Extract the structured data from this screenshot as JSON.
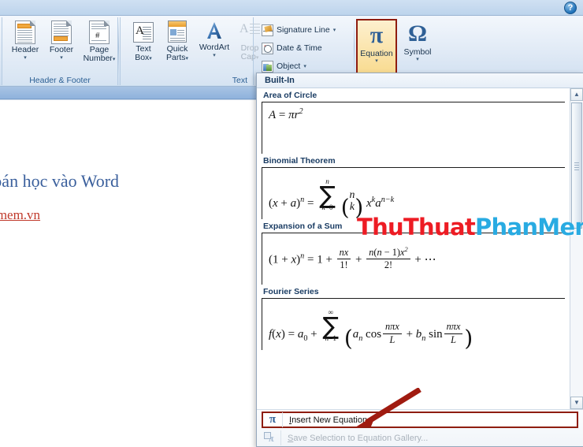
{
  "window": {
    "help_icon": "help-circle-icon",
    "help_label": "?"
  },
  "ribbon": {
    "groups": [
      {
        "label": "Header & Footer"
      },
      {
        "label": "Text"
      }
    ],
    "header_footer": {
      "buttons": [
        {
          "label": "Header",
          "caret": "▾",
          "icon": "header-document-icon"
        },
        {
          "label": "Footer",
          "caret": "▾",
          "icon": "footer-document-icon"
        },
        {
          "label_line1": "Page",
          "label_line2": "Number",
          "caret": "▾",
          "icon": "page-number-icon"
        }
      ]
    },
    "text_group": {
      "buttons": [
        {
          "label_line1": "Text",
          "label_line2": "Box",
          "caret": "▾",
          "icon": "text-box-icon",
          "disabled": false
        },
        {
          "label_line1": "Quick",
          "label_line2": "Parts",
          "caret": "▾",
          "icon": "quick-parts-icon",
          "disabled": false
        },
        {
          "label_line1": "WordArt",
          "label_line2": "",
          "caret": "▾",
          "icon": "wordart-icon",
          "disabled": false
        },
        {
          "label_line1": "Drop",
          "label_line2": "Cap",
          "caret": "▾",
          "icon": "drop-cap-icon",
          "disabled": true
        }
      ],
      "commands": [
        {
          "label": "Signature Line",
          "caret": "▾",
          "icon": "signature-line-icon"
        },
        {
          "label": "Date & Time",
          "caret": "",
          "icon": "date-time-icon"
        },
        {
          "label": "Object",
          "caret": "▾",
          "icon": "object-icon"
        }
      ],
      "equation_button": {
        "label": "Equation",
        "glyph": "π",
        "caret": "▾",
        "icon": "equation-pi-icon",
        "active": true,
        "highlight_color": "#8f1d10"
      },
      "symbol_button": {
        "label": "Symbol",
        "glyph": "Ω",
        "caret": "▾",
        "icon": "symbol-omega-icon"
      }
    }
  },
  "document": {
    "heading": "ức toán học vào Word",
    "link": "uatphanmem.vn"
  },
  "gallery": {
    "title": "Built-In",
    "items": [
      {
        "label": "Area of Circle",
        "formula_plain": "A = πr²"
      },
      {
        "label": "Binomial Theorem",
        "formula_plain": "(x + a)^n = Σ(k=0..n) (n choose k) x^k a^(n−k)"
      },
      {
        "label": "Expansion of a Sum",
        "formula_plain": "(1 + x)^n = 1 + nx/1! + n(n−1)x²/2! + ···"
      },
      {
        "label": "Fourier Series",
        "formula_plain": "f(x) = a₀ + Σ(n=1..∞) (aₙ cos(nπx/L) + bₙ sin(nπx/L))"
      }
    ],
    "scrollbar": {
      "up_arrow": "▲",
      "down_arrow": "▼"
    },
    "commands": [
      {
        "label": "Insert New Equation",
        "icon": "equation-pi-icon",
        "disabled": false,
        "highlighted": true
      },
      {
        "label": "Save Selection to Equation Gallery...",
        "icon": "save-equation-icon",
        "disabled": true,
        "highlighted": false
      }
    ]
  },
  "watermark": {
    "part1": "ThuThuat",
    "part2": "PhanMem.vn",
    "color1": "#ed1c24",
    "color2": "#29abe2"
  },
  "annotation": {
    "arrow_color": "#a01b10",
    "name": "red-arrow-pointer"
  }
}
